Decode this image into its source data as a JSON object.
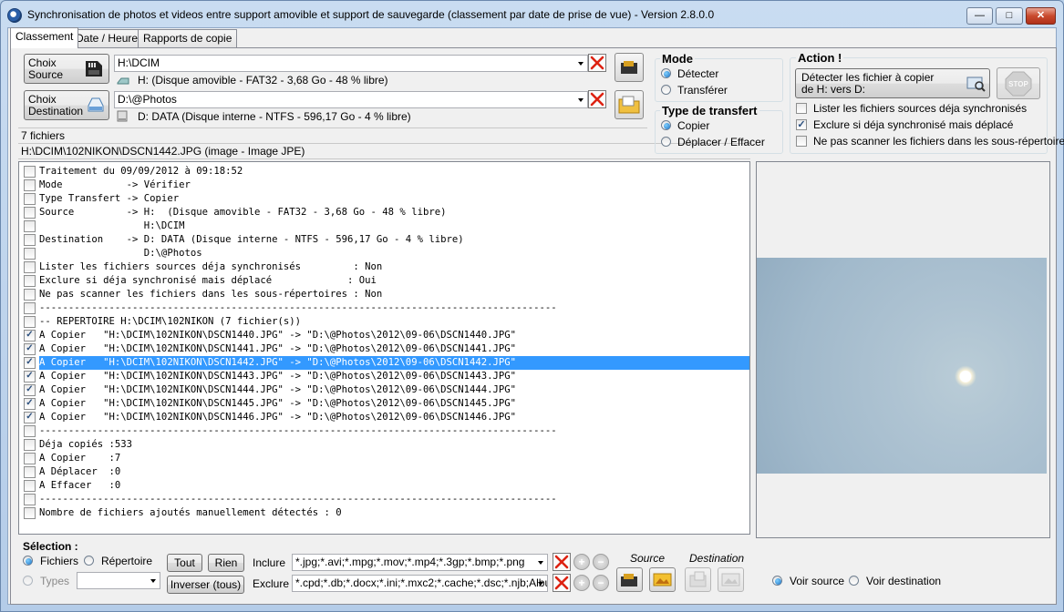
{
  "window": {
    "title": "Synchronisation de photos et videos entre support amovible et support de sauvegarde (classement par date de prise de vue) - Version 2.8.0.0",
    "controls": {
      "minimize": "—",
      "maximize": "□",
      "close": "✕"
    }
  },
  "tabs": [
    "Classement",
    "Date / Heure",
    "Rapports de copie"
  ],
  "source": {
    "button_line1": "Choix",
    "button_line2": "Source",
    "path": "H:\\DCIM",
    "drive_info": "H:  (Disque amovible - FAT32 - 3,68 Go - 48 % libre)"
  },
  "destination": {
    "button_line1": "Choix",
    "button_line2": "Destination",
    "path": "D:\\@Photos",
    "drive_info": "D: DATA (Disque interne - NTFS - 596,17 Go - 4 % libre)"
  },
  "status": {
    "file_count": "7 fichiers",
    "current_file": "H:\\DCIM\\102NIKON\\DSCN1442.JPG (image - Image JPE)"
  },
  "mode": {
    "title": "Mode",
    "options": [
      "Détecter",
      "Transférer"
    ],
    "selected": "Détecter"
  },
  "transfer_type": {
    "title": "Type de transfert",
    "options": [
      "Copier",
      "Déplacer / Effacer"
    ],
    "selected": "Copier"
  },
  "action": {
    "title": "Action !",
    "button_line1": "Détecter les fichier à copier",
    "button_line2": "de H: vers D:",
    "stop_label": "STOP",
    "options": [
      {
        "label": "Lister les fichiers sources déja synchronisés",
        "checked": false
      },
      {
        "label": "Exclure si déja synchronisé mais déplacé",
        "checked": true
      },
      {
        "label": "Ne pas scanner les fichiers dans les sous-répertoires",
        "checked": false
      }
    ]
  },
  "log": [
    {
      "text": "Traitement du 09/09/2012 à 09:18:52",
      "checked": false
    },
    {
      "text": "Mode           -> Vérifier",
      "checked": false
    },
    {
      "text": "Type Transfert -> Copier",
      "checked": false
    },
    {
      "text": "Source         -> H:  (Disque amovible - FAT32 - 3,68 Go - 48 % libre)",
      "checked": false
    },
    {
      "text": "                  H:\\DCIM",
      "checked": false
    },
    {
      "text": "Destination    -> D: DATA (Disque interne - NTFS - 596,17 Go - 4 % libre)",
      "checked": false
    },
    {
      "text": "                  D:\\@Photos",
      "checked": false
    },
    {
      "text": "Lister les fichiers sources déja synchronisés         : Non",
      "checked": false
    },
    {
      "text": "Exclure si déja synchronisé mais déplacé             : Oui",
      "checked": false
    },
    {
      "text": "Ne pas scanner les fichiers dans les sous-répertoires : Non",
      "checked": false
    },
    {
      "text": "-----------------------------------------------------------------------------------------",
      "checked": false
    },
    {
      "text": "-- REPERTOIRE H:\\DCIM\\102NIKON (7 fichier(s))",
      "checked": false
    },
    {
      "text": "A Copier   \"H:\\DCIM\\102NIKON\\DSCN1440.JPG\" -> \"D:\\@Photos\\2012\\09-06\\DSCN1440.JPG\"",
      "checked": true
    },
    {
      "text": "A Copier   \"H:\\DCIM\\102NIKON\\DSCN1441.JPG\" -> \"D:\\@Photos\\2012\\09-06\\DSCN1441.JPG\"",
      "checked": true
    },
    {
      "text": "A Copier   \"H:\\DCIM\\102NIKON\\DSCN1442.JPG\" -> \"D:\\@Photos\\2012\\09-06\\DSCN1442.JPG\"",
      "checked": true,
      "selected": true
    },
    {
      "text": "A Copier   \"H:\\DCIM\\102NIKON\\DSCN1443.JPG\" -> \"D:\\@Photos\\2012\\09-06\\DSCN1443.JPG\"",
      "checked": true
    },
    {
      "text": "A Copier   \"H:\\DCIM\\102NIKON\\DSCN1444.JPG\" -> \"D:\\@Photos\\2012\\09-06\\DSCN1444.JPG\"",
      "checked": true
    },
    {
      "text": "A Copier   \"H:\\DCIM\\102NIKON\\DSCN1445.JPG\" -> \"D:\\@Photos\\2012\\09-06\\DSCN1445.JPG\"",
      "checked": true
    },
    {
      "text": "A Copier   \"H:\\DCIM\\102NIKON\\DSCN1446.JPG\" -> \"D:\\@Photos\\2012\\09-06\\DSCN1446.JPG\"",
      "checked": true
    },
    {
      "text": "-----------------------------------------------------------------------------------------",
      "checked": false
    },
    {
      "text": "Déja copiés :533",
      "checked": false
    },
    {
      "text": "A Copier    :7",
      "checked": false
    },
    {
      "text": "A Déplacer  :0",
      "checked": false
    },
    {
      "text": "A Effacer   :0",
      "checked": false
    },
    {
      "text": "-----------------------------------------------------------------------------------------",
      "checked": false
    },
    {
      "text": "Nombre de fichiers ajoutés manuellement détectés : 0",
      "checked": false
    }
  ],
  "selection": {
    "title": "Sélection :",
    "fichiers_label": "Fichiers",
    "repertoire_label": "Répertoire",
    "types_label": "Types",
    "types_value": "",
    "tout_label": "Tout",
    "rien_label": "Rien",
    "inverser_label": "Inverser (tous)",
    "include_label": "Inclure",
    "include_value": "*.jpg;*.avi;*.mpg;*.mov;*.mp4;*.3gp;*.bmp;*.png",
    "exclude_label": "Exclure",
    "exclude_value": "*.cpd;*.db;*.docx;*.ini;*.mxc2;*.cache;*.dsc;*.njb;Album",
    "source_label": "Source",
    "destination_label": "Destination"
  },
  "preview": {
    "voir_source": "Voir source",
    "voir_destination": "Voir destination",
    "selected": "Voir source"
  }
}
